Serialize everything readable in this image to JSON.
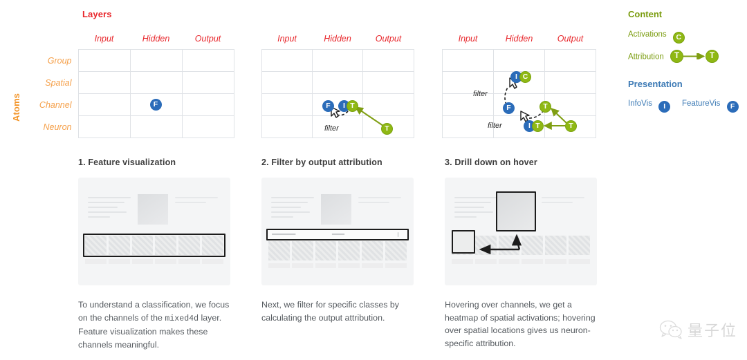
{
  "matrix": {
    "col_axis_title": "Layers",
    "row_axis_title": "Atoms",
    "columns": [
      "Input",
      "Hidden",
      "Output"
    ],
    "rows": [
      "Group",
      "Spatial",
      "Channel",
      "Neuron"
    ],
    "filter_label": "filter",
    "grids": [
      {
        "id": "grid-1",
        "badges": [
          {
            "letter": "F",
            "kind": "featurevis",
            "row": "Channel",
            "col": "Hidden"
          }
        ]
      },
      {
        "id": "grid-2",
        "badges": [
          {
            "letter": "F",
            "kind": "featurevis",
            "row": "Channel",
            "col": "Hidden"
          },
          {
            "letter": "I",
            "kind": "infovis",
            "row": "Channel",
            "col": "Hidden"
          },
          {
            "letter": "T",
            "kind": "attribution",
            "row": "Channel",
            "col": "Hidden"
          },
          {
            "letter": "T",
            "kind": "attribution",
            "row": "Neuron",
            "col": "Output"
          }
        ],
        "filters": [
          "filter"
        ]
      },
      {
        "id": "grid-3",
        "badges": [
          {
            "letter": "I",
            "kind": "infovis",
            "row": "Spatial",
            "col": "Hidden"
          },
          {
            "letter": "C",
            "kind": "activations",
            "row": "Spatial",
            "col": "Hidden"
          },
          {
            "letter": "F",
            "kind": "featurevis",
            "row": "Channel",
            "col": "Hidden"
          },
          {
            "letter": "T",
            "kind": "attribution",
            "row": "Channel",
            "col": "Hidden"
          },
          {
            "letter": "I",
            "kind": "infovis",
            "row": "Neuron",
            "col": "Hidden"
          },
          {
            "letter": "T",
            "kind": "attribution",
            "row": "Neuron",
            "col": "Hidden"
          },
          {
            "letter": "T",
            "kind": "attribution",
            "row": "Neuron",
            "col": "Output"
          }
        ],
        "filters": [
          "filter",
          "filter"
        ]
      }
    ]
  },
  "legend": {
    "content": {
      "heading": "Content",
      "items": [
        {
          "label": "Activations",
          "badge": "C",
          "kind": "activations"
        },
        {
          "label": "Attribution",
          "badge": "T",
          "badge2": "T",
          "kind": "attribution",
          "arrow": true
        }
      ]
    },
    "presentation": {
      "heading": "Presentation",
      "items": [
        {
          "label": "InfoVis",
          "badge": "I",
          "kind": "infovis"
        },
        {
          "label": "FeatureVis",
          "badge": "F",
          "kind": "featurevis"
        }
      ]
    }
  },
  "steps": [
    {
      "title": "1. Feature visualization",
      "caption_before": "To understand a classification, we focus on the channels of the ",
      "caption_code": "mixed4d",
      "caption_after": " layer. Feature visualization makes these channels meaningful."
    },
    {
      "title": "2. Filter by output attribution",
      "caption_before": "Next, we filter for specific classes by calculating the output attribution.",
      "caption_code": "",
      "caption_after": ""
    },
    {
      "title": "3. Drill down on hover",
      "caption_before": "Hovering over channels, we get a heatmap of spatial activations; hovering over spatial locations gives us neuron-specific attribution.",
      "caption_code": "",
      "caption_after": ""
    }
  ],
  "watermark": {
    "icon": "wechat-icon",
    "text": "量子位"
  },
  "colors": {
    "layers_title": "#e8262b",
    "atoms_title": "#f39325",
    "column_header": "#e8262b",
    "row_header": "#f5a04a",
    "infovis": "#2b6cb9",
    "featurevis": "#2b6cb9",
    "activations": "#8fb814",
    "attribution": "#8fb814",
    "content_heading": "#7a9c0e",
    "presentation_heading": "#3c7ab5",
    "grid_line": "#dfe2e6"
  }
}
